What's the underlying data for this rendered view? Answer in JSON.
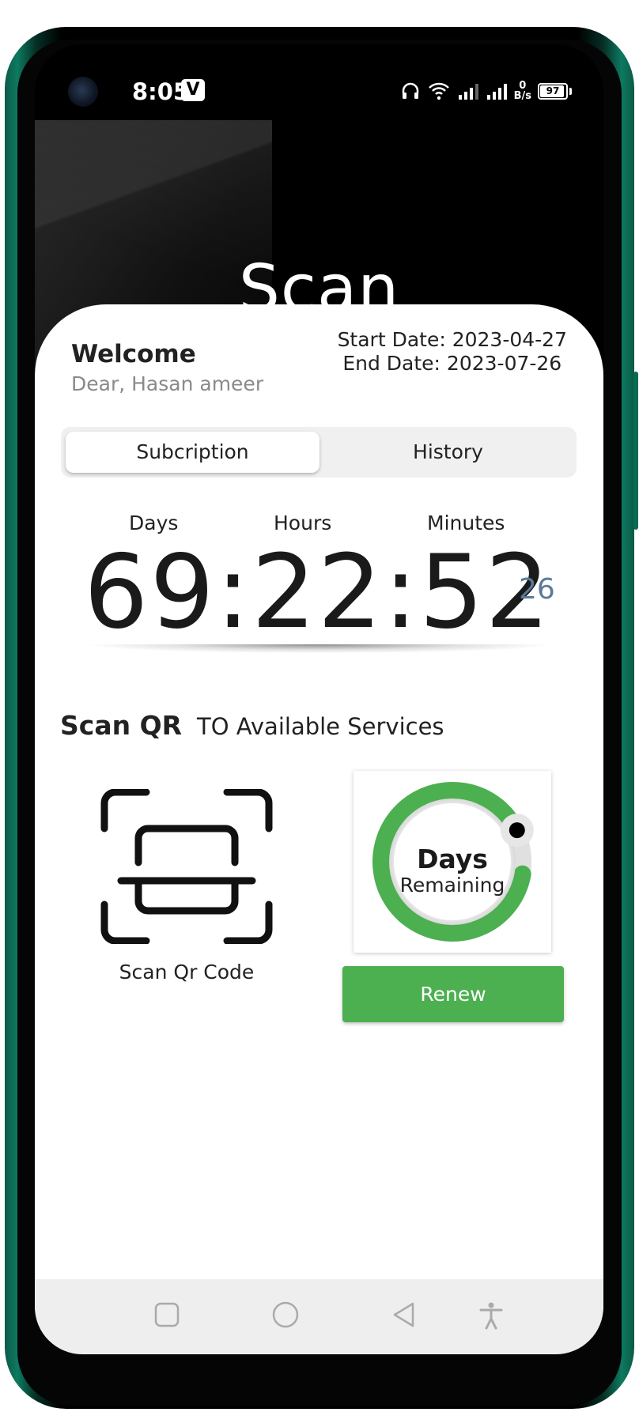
{
  "status_bar": {
    "time": "8:05",
    "app_badge": "V",
    "net_speed_value": "0",
    "net_speed_unit": "B/s",
    "battery": "97"
  },
  "page_title": "Scan",
  "welcome": {
    "title": "Welcome",
    "subtitle": "Dear, Hasan ameer"
  },
  "subscription_dates": {
    "start": "Start Date: 2023-04-27",
    "end": "End Date: 2023-07-26"
  },
  "tabs": [
    {
      "label": "Subcription",
      "active": true
    },
    {
      "label": "History",
      "active": false
    }
  ],
  "countdown": {
    "labels": {
      "days": "Days",
      "hours": "Hours",
      "minutes": "Minutes"
    },
    "value": "69:22:52",
    "seconds": "26"
  },
  "scan_section": {
    "title": "Scan QR",
    "subtitle": "TO Available Services",
    "qr_label": "Scan Qr Code"
  },
  "days_remaining": {
    "title": "Days",
    "subtitle": "Remaining",
    "progress_fraction": 0.9
  },
  "renew_button": "Renew",
  "colors": {
    "accent": "#4caf50",
    "seconds_text": "#5a7a9a",
    "frame": "#0d7a60"
  },
  "nav_icons": [
    "square-icon",
    "circle-icon",
    "back-triangle-icon",
    "accessibility-icon"
  ]
}
